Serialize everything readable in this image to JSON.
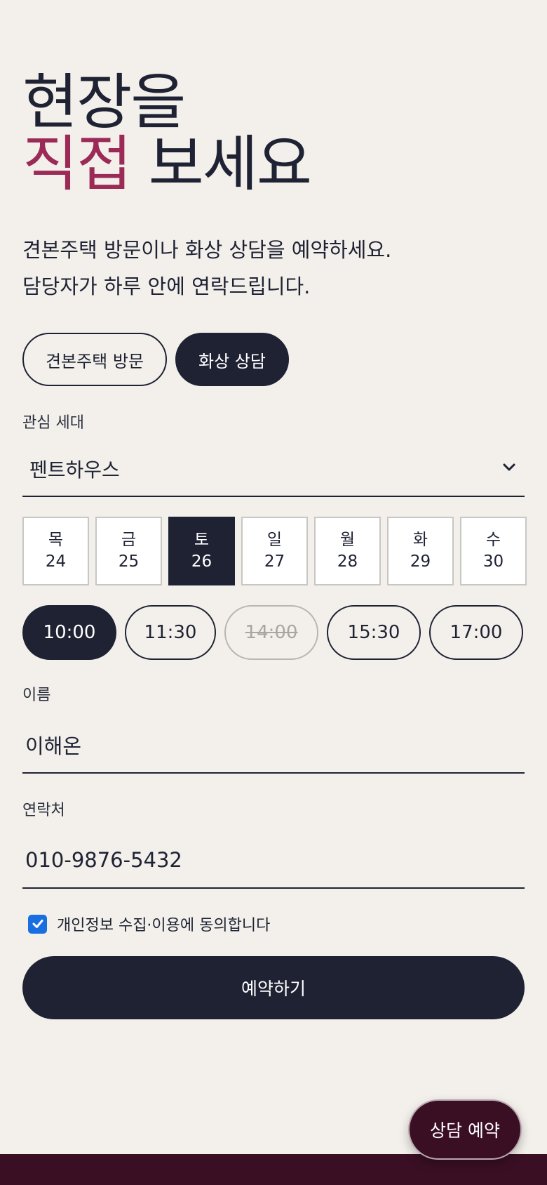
{
  "headline": {
    "line1": "현장을",
    "line2_accent": "직접",
    "line2_rest": "보세요"
  },
  "lead": {
    "line1": "견본주택 방문이나 화상 상담을 예약하세요.",
    "line2": "담당자가 하루 안에 연락드립니다."
  },
  "mode_tabs": [
    {
      "label": "견본주택 방문",
      "active": false
    },
    {
      "label": "화상 상담",
      "active": true
    }
  ],
  "unit_field": {
    "label": "관심 세대",
    "value": "펜트하우스",
    "icon": "chevron-down-icon"
  },
  "days": [
    {
      "weekday": "목",
      "date": "24"
    },
    {
      "weekday": "금",
      "date": "25"
    },
    {
      "weekday": "토",
      "date": "26",
      "active": true
    },
    {
      "weekday": "일",
      "date": "27"
    },
    {
      "weekday": "월",
      "date": "28"
    },
    {
      "weekday": "화",
      "date": "29"
    },
    {
      "weekday": "수",
      "date": "30"
    }
  ],
  "times": [
    {
      "label": "10:00",
      "state": "selected"
    },
    {
      "label": "11:30",
      "state": "available"
    },
    {
      "label": "14:00",
      "state": "unavailable"
    },
    {
      "label": "15:30",
      "state": "available"
    },
    {
      "label": "17:00",
      "state": "available"
    }
  ],
  "name_field": {
    "label": "이름",
    "value": "이해온"
  },
  "phone_field": {
    "label": "연락처",
    "value": "010-9876-5432"
  },
  "consent": {
    "label": "개인정보 수집·이용에 동의합니다",
    "checked": true
  },
  "submit_label": "예약하기",
  "fab_label": "상담 예약",
  "colors": {
    "primary": "#1e2233",
    "accent": "#9b2a56",
    "background": "#f3f0eb",
    "footer": "#3a0f24",
    "checkbox": "#1a6fe0"
  }
}
